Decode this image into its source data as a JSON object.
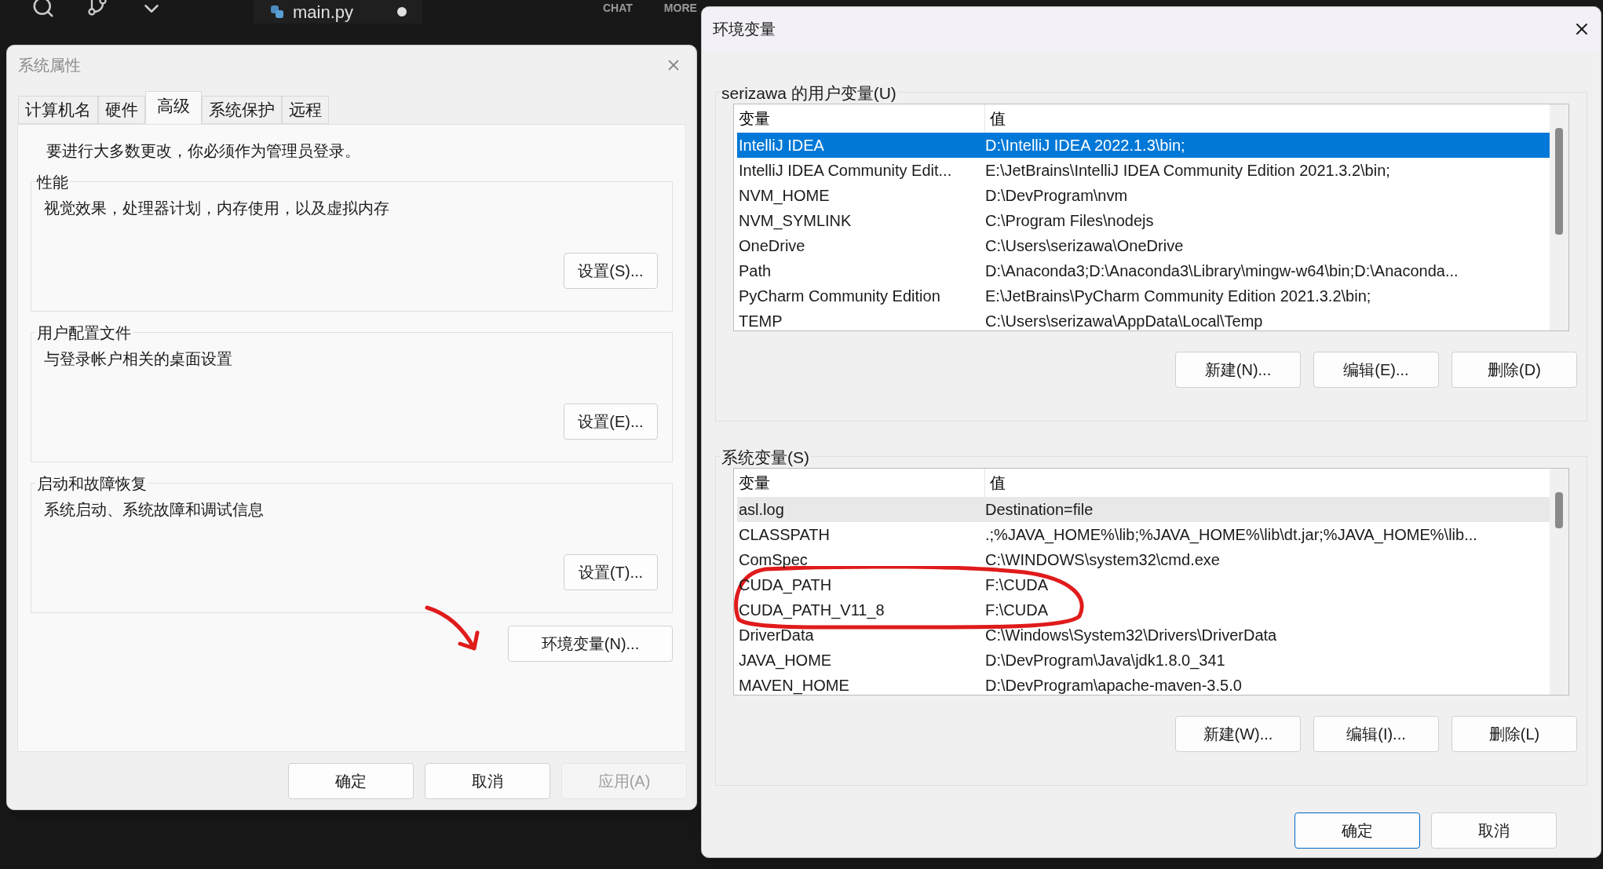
{
  "editor": {
    "tab": {
      "label": "main.py",
      "modified": true
    },
    "panel_tabs": [
      "CHAT",
      "MORE"
    ]
  },
  "system_properties": {
    "title": "系统属性",
    "tabs": [
      {
        "label": "计算机名",
        "selected": false
      },
      {
        "label": "硬件",
        "selected": false
      },
      {
        "label": "高级",
        "selected": true
      },
      {
        "label": "系统保护",
        "selected": false
      },
      {
        "label": "远程",
        "selected": false
      }
    ],
    "notice": "要进行大多数更改，你必须作为管理员登录。",
    "groups": [
      {
        "title": "性能",
        "description": "视觉效果，处理器计划，内存使用，以及虚拟内存",
        "button": "设置(S)..."
      },
      {
        "title": "用户配置文件",
        "description": "与登录帐户相关的桌面设置",
        "button": "设置(E)..."
      },
      {
        "title": "启动和故障恢复",
        "description": "系统启动、系统故障和调试信息",
        "button": "设置(T)..."
      }
    ],
    "env_button": "环境变量(N)...",
    "buttons": [
      {
        "label": "确定",
        "disabled": false
      },
      {
        "label": "取消",
        "disabled": false
      },
      {
        "label": "应用(A)",
        "disabled": true
      }
    ]
  },
  "environment_variables": {
    "title": "环境变量",
    "sections": [
      {
        "title": "serizawa 的用户变量(U)",
        "columns": [
          "变量",
          "值"
        ],
        "rows": [
          {
            "name": "IntelliJ IDEA",
            "value": "D:\\IntelliJ IDEA 2022.1.3\\bin;",
            "selected": true,
            "hovered": false
          },
          {
            "name": "IntelliJ IDEA Community Edit...",
            "value": "E:\\JetBrains\\IntelliJ IDEA Community Edition 2021.3.2\\bin;",
            "selected": false,
            "hovered": false
          },
          {
            "name": "NVM_HOME",
            "value": "D:\\DevProgram\\nvm",
            "selected": false,
            "hovered": false
          },
          {
            "name": "NVM_SYMLINK",
            "value": "C:\\Program Files\\nodejs",
            "selected": false,
            "hovered": false
          },
          {
            "name": "OneDrive",
            "value": "C:\\Users\\serizawa\\OneDrive",
            "selected": false,
            "hovered": false
          },
          {
            "name": "Path",
            "value": "D:\\Anaconda3;D:\\Anaconda3\\Library\\mingw-w64\\bin;D:\\Anaconda...",
            "selected": false,
            "hovered": false
          },
          {
            "name": "PyCharm Community Edition",
            "value": "E:\\JetBrains\\PyCharm Community Edition 2021.3.2\\bin;",
            "selected": false,
            "hovered": false
          },
          {
            "name": "TEMP",
            "value": "C:\\Users\\serizawa\\AppData\\Local\\Temp",
            "selected": false,
            "hovered": false
          }
        ],
        "buttons": [
          "新建(N)...",
          "编辑(E)...",
          "删除(D)"
        ]
      },
      {
        "title": "系统变量(S)",
        "columns": [
          "变量",
          "值"
        ],
        "rows": [
          {
            "name": "asl.log",
            "value": "Destination=file",
            "selected": false,
            "hovered": true
          },
          {
            "name": "CLASSPATH",
            "value": ".;%JAVA_HOME%\\lib;%JAVA_HOME%\\lib\\dt.jar;%JAVA_HOME%\\lib...",
            "selected": false,
            "hovered": false
          },
          {
            "name": "ComSpec",
            "value": "C:\\WINDOWS\\system32\\cmd.exe",
            "selected": false,
            "hovered": false
          },
          {
            "name": "CUDA_PATH",
            "value": "F:\\CUDA",
            "selected": false,
            "hovered": false
          },
          {
            "name": "CUDA_PATH_V11_8",
            "value": "F:\\CUDA",
            "selected": false,
            "hovered": false
          },
          {
            "name": "DriverData",
            "value": "C:\\Windows\\System32\\Drivers\\DriverData",
            "selected": false,
            "hovered": false
          },
          {
            "name": "JAVA_HOME",
            "value": "D:\\DevProgram\\Java\\jdk1.8.0_341",
            "selected": false,
            "hovered": false
          },
          {
            "name": "MAVEN_HOME",
            "value": "D:\\DevProgram\\apache-maven-3.5.0",
            "selected": false,
            "hovered": false
          }
        ],
        "buttons": [
          "新建(W)...",
          "编辑(I)...",
          "删除(L)"
        ]
      }
    ],
    "buttons": [
      {
        "label": "确定",
        "default": true
      },
      {
        "label": "取消",
        "default": false
      }
    ]
  }
}
